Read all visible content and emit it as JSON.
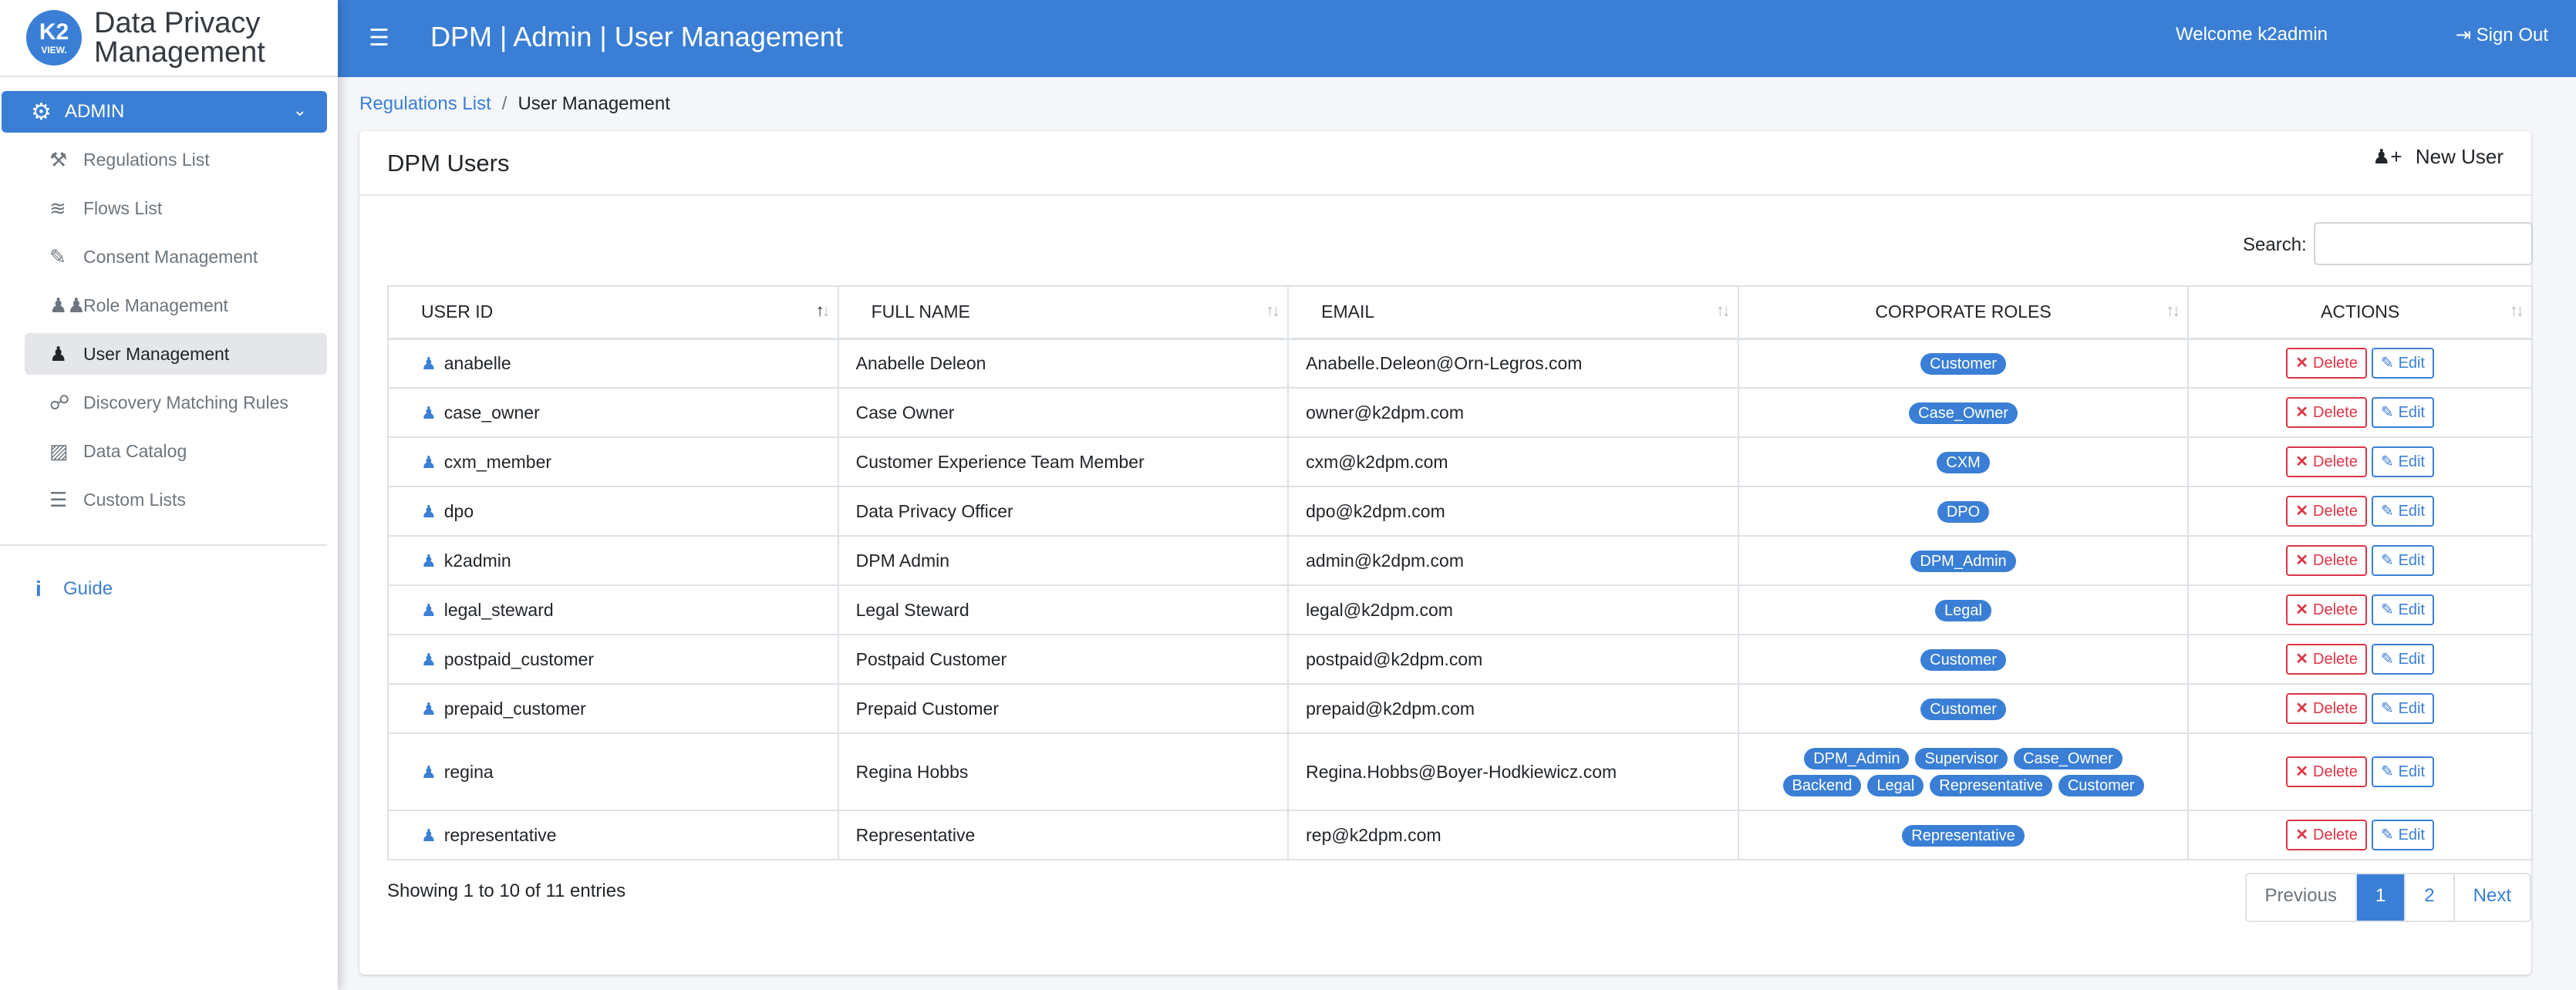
{
  "brand": {
    "logo_main": "K2",
    "logo_sub": "VIEW.",
    "line1": "Data Privacy",
    "line2": "Management"
  },
  "header": {
    "title": "DPM | Admin | User Management",
    "welcome": "Welcome k2admin",
    "sign_out": "Sign Out"
  },
  "sidebar": {
    "section_label": "ADMIN",
    "items": [
      {
        "label": "Regulations List",
        "icon": "gavel-icon"
      },
      {
        "label": "Flows List",
        "icon": "flows-icon"
      },
      {
        "label": "Consent Management",
        "icon": "consent-icon"
      },
      {
        "label": "Role Management",
        "icon": "users-icon"
      },
      {
        "label": "User Management",
        "icon": "user-icon",
        "active": true
      },
      {
        "label": "Discovery Matching Rules",
        "icon": "binoculars-icon"
      },
      {
        "label": "Data Catalog",
        "icon": "sitemap-icon"
      },
      {
        "label": "Custom Lists",
        "icon": "list-icon"
      }
    ],
    "guide": "Guide"
  },
  "breadcrumb": {
    "link": "Regulations List",
    "separator": "/",
    "current": "User Management"
  },
  "card": {
    "title": "DPM Users",
    "new_user": "New User",
    "search_label": "Search:",
    "search_value": ""
  },
  "table": {
    "headers": {
      "user_id": "USER ID",
      "full_name": "FULL NAME",
      "email": "EMAIL",
      "roles": "CORPORATE ROLES",
      "actions": "ACTIONS"
    },
    "sorted_column": "user_id",
    "sort_direction": "ascending",
    "delete_label": "Delete",
    "edit_label": "Edit",
    "rows": [
      {
        "user_id": "anabelle",
        "full_name": "Anabelle Deleon",
        "email": "Anabelle.Deleon@Orn-Legros.com",
        "roles": [
          "Customer"
        ]
      },
      {
        "user_id": "case_owner",
        "full_name": "Case Owner",
        "email": "owner@k2dpm.com",
        "roles": [
          "Case_Owner"
        ]
      },
      {
        "user_id": "cxm_member",
        "full_name": "Customer Experience Team Member",
        "email": "cxm@k2dpm.com",
        "roles": [
          "CXM"
        ]
      },
      {
        "user_id": "dpo",
        "full_name": "Data Privacy Officer",
        "email": "dpo@k2dpm.com",
        "roles": [
          "DPO"
        ]
      },
      {
        "user_id": "k2admin",
        "full_name": "DPM Admin",
        "email": "admin@k2dpm.com",
        "roles": [
          "DPM_Admin"
        ]
      },
      {
        "user_id": "legal_steward",
        "full_name": "Legal Steward",
        "email": "legal@k2dpm.com",
        "roles": [
          "Legal"
        ]
      },
      {
        "user_id": "postpaid_customer",
        "full_name": "Postpaid Customer",
        "email": "postpaid@k2dpm.com",
        "roles": [
          "Customer"
        ]
      },
      {
        "user_id": "prepaid_customer",
        "full_name": "Prepaid Customer",
        "email": "prepaid@k2dpm.com",
        "roles": [
          "Customer"
        ]
      },
      {
        "user_id": "regina",
        "full_name": "Regina Hobbs",
        "email": "Regina.Hobbs@Boyer-Hodkiewicz.com",
        "roles": [
          "DPM_Admin",
          "Supervisor",
          "Case_Owner",
          "Backend",
          "Legal",
          "Representative",
          "Customer"
        ]
      },
      {
        "user_id": "representative",
        "full_name": "Representative",
        "email": "rep@k2dpm.com",
        "roles": [
          "Representative"
        ]
      }
    ]
  },
  "footer": {
    "showing": "Showing 1 to 10 of 11 entries",
    "pagination": {
      "previous": "Previous",
      "pages": [
        "1",
        "2"
      ],
      "current_page": "1",
      "next": "Next"
    }
  },
  "colors": {
    "primary": "#3a7fd5",
    "danger": "#dc3545",
    "sidebar_active": "#e4e6e9"
  }
}
